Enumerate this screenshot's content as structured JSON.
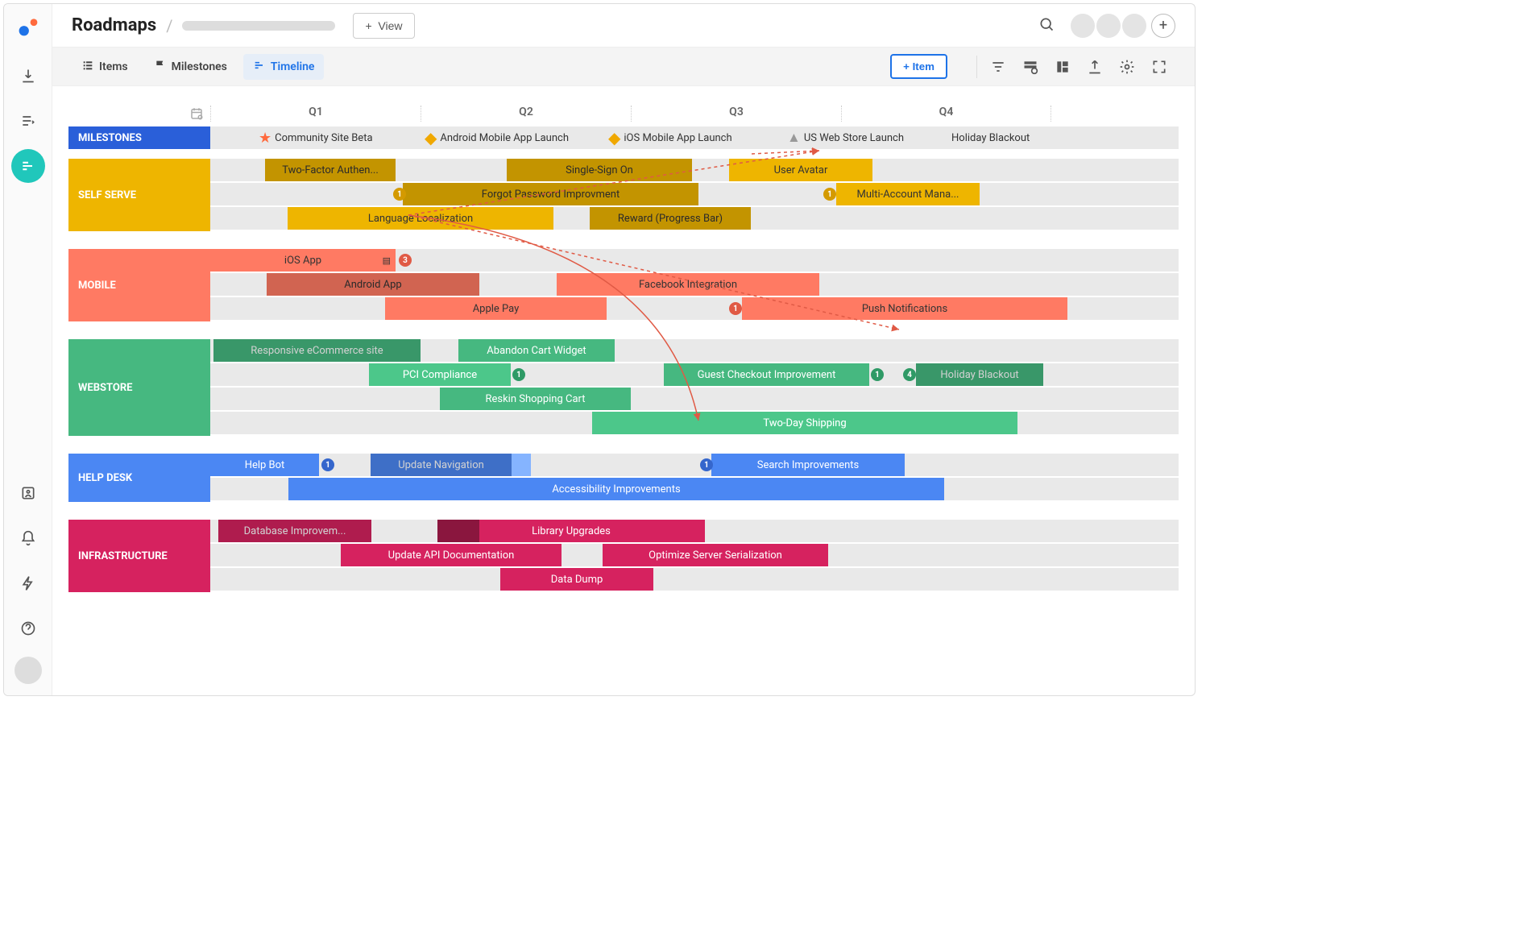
{
  "header": {
    "title": "Roadmaps",
    "view_btn": "View",
    "plus": "+"
  },
  "tabs": {
    "items": "Items",
    "milestones": "Milestones",
    "timeline": "Timeline"
  },
  "add_item_btn": "+  Item",
  "quarters": {
    "q1": "Q1",
    "q2": "Q2",
    "q3": "Q3",
    "q4": "Q4"
  },
  "milestones": {
    "label": "MILESTONES",
    "items": {
      "community": "Community Site Beta",
      "android": "Android Mobile App Launch",
      "ios": "iOS Mobile App Launch",
      "usweb": "US Web Store Launch",
      "holiday": "Holiday Blackout"
    }
  },
  "lanes": {
    "self_serve": {
      "label": "SELF SERVE",
      "two_factor": "Two-Factor Authen...",
      "sso": "Single-Sign On",
      "avatar": "User Avatar",
      "forgot_pw": "Forgot Password Improvment",
      "multi_acct": "Multi-Account Mana...",
      "lang": "Language Localization",
      "reward": "Reward (Progress Bar)",
      "b1": "1",
      "b2": "1"
    },
    "mobile": {
      "label": "MOBILE",
      "ios": "iOS App",
      "android": "Android App",
      "facebook": "Facebook Integration",
      "applepay": "Apple Pay",
      "push": "Push Notifications",
      "b_ios": "3",
      "b_push": "1"
    },
    "webstore": {
      "label": "WEBSTORE",
      "responsive": "Responsive eCommerce site",
      "abandon": "Abandon Cart Widget",
      "pci": "PCI Compliance",
      "guest": "Guest Checkout Improvement",
      "holiday": "Holiday Blackout",
      "reskin": "Reskin Shopping Cart",
      "two_day": "Two-Day Shipping",
      "b_pci": "1",
      "b_guest": "1",
      "b_hol": "4"
    },
    "helpdesk": {
      "label": "HELP DESK",
      "helpbot": "Help Bot",
      "updatenav": "Update Navigation",
      "search": "Search Improvements",
      "a11y": "Accessibility Improvements",
      "b_hb": "1",
      "b_nav": "1"
    },
    "infra": {
      "label": "INFRASTRUCTURE",
      "db": "Database Improvem...",
      "lib": "Library Upgrades",
      "api": "Update API Documentation",
      "optimize": "Optimize Server Serialization",
      "datadump": "Data Dump"
    }
  },
  "colors": {
    "milestone_lane": "#2a5fd9",
    "self_serve": "#eeb500",
    "mobile": "#ff7a63",
    "webstore": "#46b880",
    "helpdesk": "#4b87f3",
    "infra": "#d6225f"
  }
}
